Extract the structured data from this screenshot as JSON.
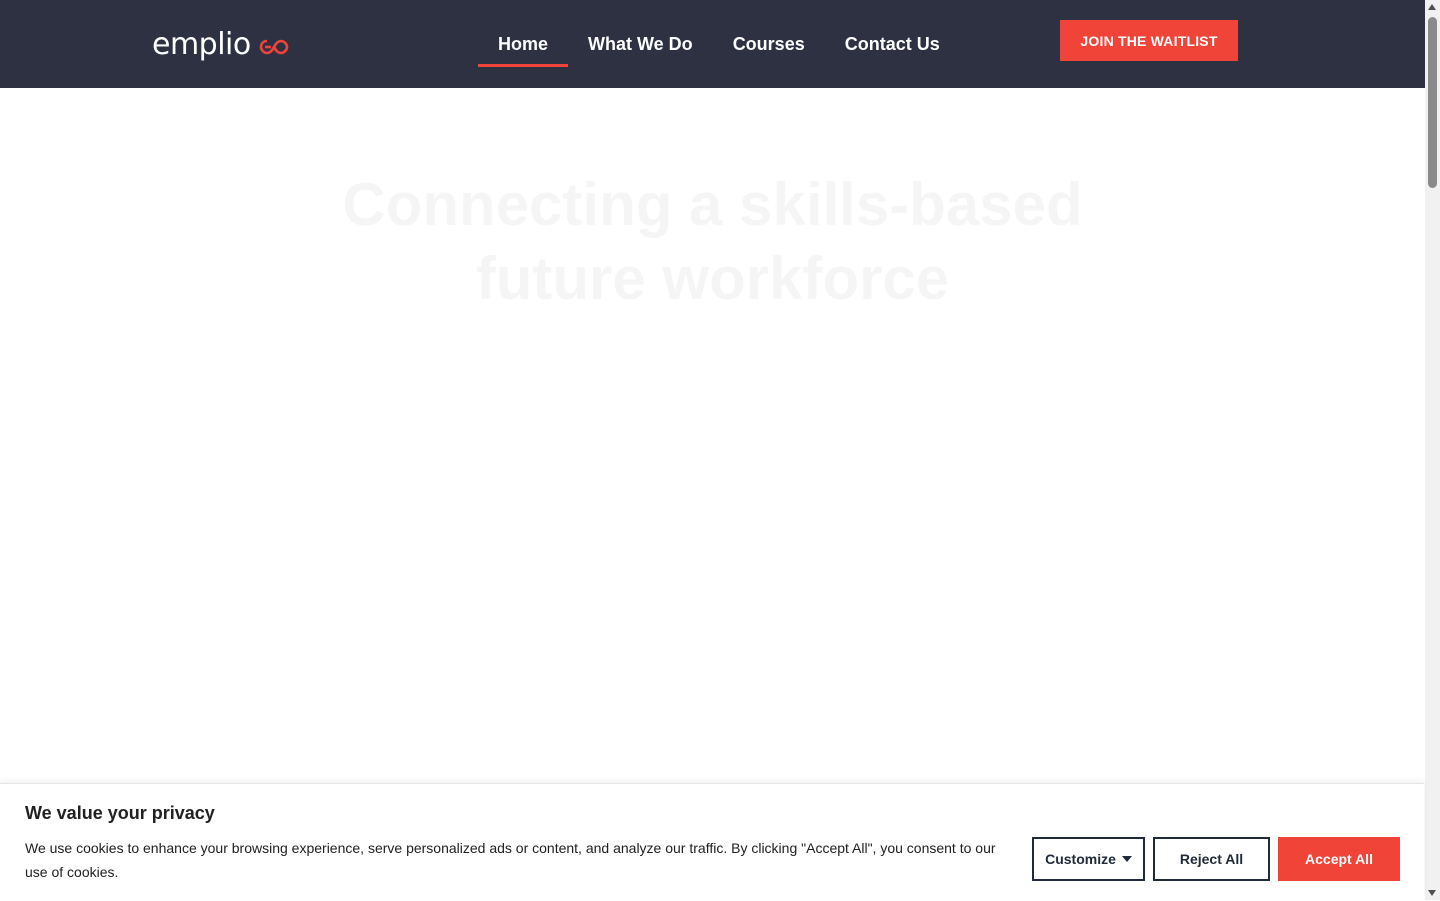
{
  "header": {
    "logo_text": "emplio",
    "logo_icon": "infinity-mark-icon",
    "nav": [
      {
        "label": "Home",
        "active": true
      },
      {
        "label": "What We Do",
        "active": false
      },
      {
        "label": "Courses",
        "active": false
      },
      {
        "label": "Contact Us",
        "active": false
      }
    ],
    "cta_label": "JOIN THE WAITLIST"
  },
  "hero": {
    "title_line1": "Connecting a skills-based",
    "title_line2": "future workforce"
  },
  "cookie": {
    "title": "We value your privacy",
    "text": "We use cookies to enhance your browsing experience, serve personalized ads or content, and analyze our traffic. By clicking \"Accept All\", you consent to our use of cookies.",
    "customize_label": "Customize",
    "reject_label": "Reject All",
    "accept_label": "Accept All"
  },
  "colors": {
    "header_bg": "#2d3142",
    "accent": "#f04438",
    "button_border": "#1f2a3a"
  }
}
